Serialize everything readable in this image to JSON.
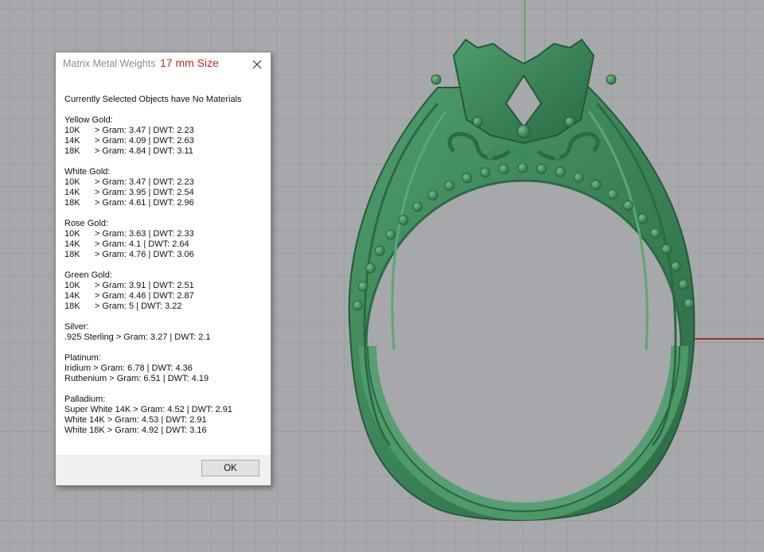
{
  "dialog": {
    "title": "Matrix Metal Weights",
    "size_label": "17 mm Size",
    "ok_label": "OK",
    "close_icon": "close-icon",
    "lines": [
      "Currently Selected Objects have No Materials",
      "",
      "Yellow Gold:",
      "10K      > Gram: 3.47 | DWT: 2.23",
      "14K      > Gram: 4.09 | DWT: 2.63",
      "18K      > Gram: 4.84 | DWT: 3.11",
      "",
      "White Gold:",
      "10K      > Gram: 3.47 | DWT: 2.23",
      "14K      > Gram: 3.95 | DWT: 2.54",
      "18K      > Gram: 4.61 | DWT: 2.96",
      "",
      "Rose Gold:",
      "10K      > Gram: 3.63 | DWT: 2.33",
      "14K      > Gram: 4.1 | DWT: 2.64",
      "18K      > Gram: 4.76 | DWT: 3.06",
      "",
      "Green Gold:",
      "10K      > Gram: 3.91 | DWT: 2.51",
      "14K      > Gram: 4.46 | DWT: 2.87",
      "18K      > Gram: 5 | DWT: 3.22",
      "",
      "Silver:",
      ".925 Sterling > Gram: 3.27 | DWT: 2.1",
      "",
      "Platinum:",
      "Iridium > Gram: 6.78 | DWT: 4.36",
      "Ruthenium > Gram: 6.51 | DWT: 4.19",
      "",
      "Palladium:",
      "Super White 14K > Gram: 4.52 | DWT: 2.91",
      "White 14K > Gram: 4.53 | DWT: 2.91",
      "White 18K > Gram: 4.92 | DWT: 3.16"
    ]
  },
  "viewport": {
    "background_color": "#a6a8ab",
    "grid_color": "#9b9da0",
    "y_axis_color": "#2aa83c",
    "x_axis_color": "#a3312a",
    "model_color": "#3f8a5c"
  }
}
